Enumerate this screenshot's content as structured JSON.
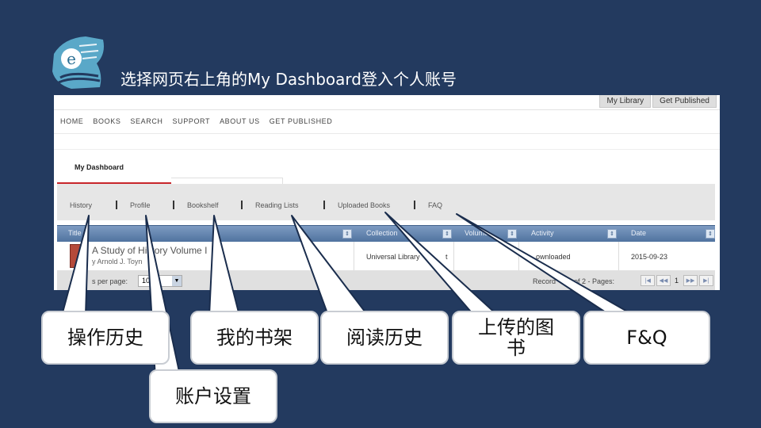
{
  "slide_title": "选择网页右上角的My Dashboard登入个人账号",
  "top_tabs": [
    "My Library",
    "Get Published"
  ],
  "main_nav": [
    "HOME",
    "BOOKS",
    "SEARCH",
    "SUPPORT",
    "ABOUT US",
    "GET PUBLISHED"
  ],
  "dashboard_tab": "My Dashboard",
  "sub_nav": [
    "History",
    "Profile",
    "Bookshelf",
    "Reading Lists",
    "Uploaded Books",
    "FAQ"
  ],
  "sub_nav_separator": "|",
  "table": {
    "headers": [
      "Title",
      "Collection",
      "Volume",
      "Activity",
      "Date"
    ],
    "row": {
      "title": "A Study of History Volume I",
      "author": "y Arnold J. Toyn",
      "collection": "Universal Library",
      "collection_tail": "t",
      "activity": "ownloaded",
      "date": "2015-09-23"
    }
  },
  "footer": {
    "per_page_label": "s per page:",
    "per_page_value": "10",
    "records_label": "Record",
    "records_tail": "of 2 - Pages:",
    "current_page": "1"
  },
  "callouts": {
    "history": "操作历史",
    "profile": "账户设置",
    "bookshelf": "我的书架",
    "reading_lists": "阅读历史",
    "uploaded_line1": "上传的图",
    "uploaded_line2": "书",
    "faq": "F&Q"
  },
  "colors": {
    "background": "#233a5f",
    "header_blue": "#5e80ab",
    "accent_red": "#c8262b",
    "logo_teal": "#5aa8c8"
  }
}
